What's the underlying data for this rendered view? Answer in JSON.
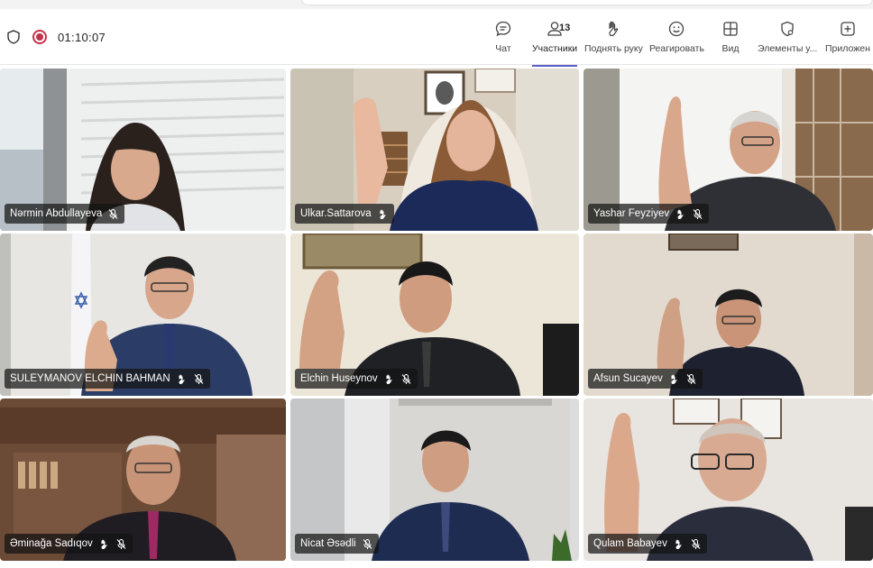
{
  "meeting": {
    "timer": "01:10:07"
  },
  "toolbar": {
    "chat": "Чат",
    "participants": "Участники",
    "participants_count": "13",
    "raise_hand": "Поднять руку",
    "react": "Реагировать",
    "view": "Вид",
    "apps_elements": "Элементы у...",
    "apps": "Приложен"
  },
  "participants": [
    {
      "name": "Nərmin Abdullayeva",
      "muted": true,
      "hand_raised": false
    },
    {
      "name": "Ulkar.Sattarova",
      "muted": false,
      "hand_raised": true
    },
    {
      "name": "Yashar Feyziyev",
      "muted": true,
      "hand_raised": true
    },
    {
      "name": "SULEYMANOV ELCHIN BAHMAN",
      "muted": true,
      "hand_raised": true
    },
    {
      "name": "Elchin Huseynov",
      "muted": true,
      "hand_raised": true
    },
    {
      "name": "Afsun Sucayev",
      "muted": true,
      "hand_raised": true
    },
    {
      "name": "Əminağa Sadıqov",
      "muted": true,
      "hand_raised": true
    },
    {
      "name": "Nicat Əsədli",
      "muted": true,
      "hand_raised": false
    },
    {
      "name": "Qulam Babayev",
      "muted": true,
      "hand_raised": true
    }
  ],
  "colors": {
    "accent": "#5b5fc7",
    "record": "#c4314b"
  }
}
